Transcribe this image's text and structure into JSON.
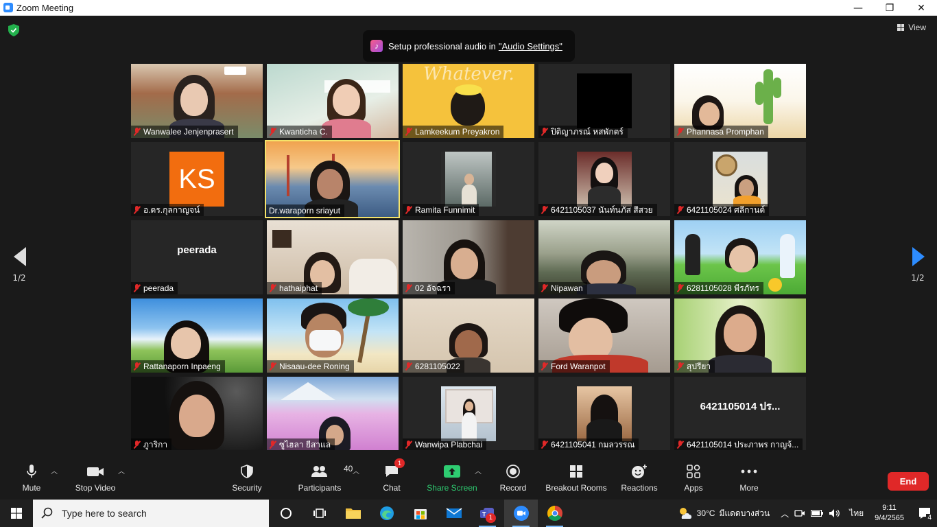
{
  "window": {
    "title": "Zoom Meeting",
    "controls": [
      "—",
      "❐",
      "✕"
    ]
  },
  "view_label": "View",
  "toast": {
    "text": "Setup professional audio in",
    "link": "\"Audio Settings\""
  },
  "pager": {
    "left": "1/2",
    "right": "1/2"
  },
  "tiles": [
    "Wanwalee Jenjenprasert",
    "Kwanticha C.",
    "Lamkeekum Preyakron",
    "ปิติญาภรณ์ หสพักตร์",
    "Phannasa Promphan",
    "อ.ดร.กุลกาญจน์",
    "Dr.waraporn sriayut",
    "Ramita Funnimit",
    "6421105037 นันท์นภัส สีสวย",
    "6421105024 ศลีกานต์",
    "peerada",
    "hathaiphat",
    "02 อัจฉรา",
    "Nipawan",
    "6281105028 พีรภัทร",
    "Rattanaporn Inpaeng",
    "Nisaau-dee Roning",
    "6281105022",
    "Ford Waranpot",
    "สุปรียา",
    "ภูาริกา",
    "ซูไฮลา ยีสาแล",
    "Wanwipa Plabchai",
    "6421105041 กมลวรรณ",
    "6421105014 ประภาพร กาญจ้..."
  ],
  "tile_overlays": {
    "ks_initials": "KS",
    "peerada_label": "peerada",
    "cut_label": "6421105014 ปร..."
  },
  "toolbar": {
    "mute": "Mute",
    "stop_video": "Stop Video",
    "security": "Security",
    "participants": "Participants",
    "participants_count": "40",
    "chat": "Chat",
    "chat_badge": "1",
    "share": "Share Screen",
    "record": "Record",
    "breakout": "Breakout Rooms",
    "reactions": "Reactions",
    "apps": "Apps",
    "more": "More",
    "end": "End"
  },
  "taskbar": {
    "search_placeholder": "Type here to search",
    "teams_badge": "1",
    "temp": "30°C",
    "weather": "มีแดดบางส่วน",
    "lang": "ไทย",
    "time": "9:11",
    "date": "9/4/2565",
    "notif_count": "4"
  },
  "colors": {
    "accent": "#2d8cff",
    "end_red": "#e02828",
    "share_green": "#2ecc71",
    "active_speaker": "#f5e36a"
  }
}
